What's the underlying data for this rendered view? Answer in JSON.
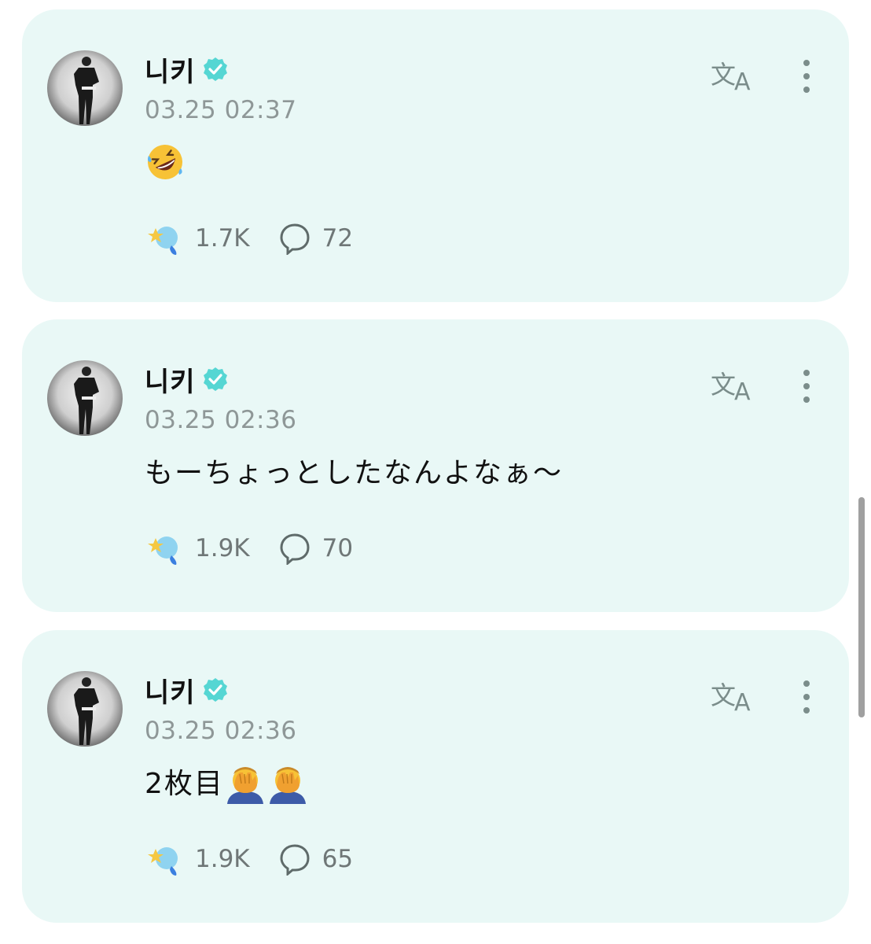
{
  "posts": [
    {
      "author": "니키",
      "verified": true,
      "timestamp": "03.25 02:37",
      "text": "",
      "emojis": [
        "rolling-on-floor-laughing"
      ],
      "reactions": "1.7K",
      "comments": "72"
    },
    {
      "author": "니키",
      "verified": true,
      "timestamp": "03.25 02:36",
      "text": "もーちょっとしたなんよなぁ〜",
      "emojis": [],
      "reactions": "1.9K",
      "comments": "70"
    },
    {
      "author": "니키",
      "verified": true,
      "timestamp": "03.25 02:36",
      "text": "2枚目",
      "emojis": [
        "face-palm",
        "face-palm"
      ],
      "reactions": "1.9K",
      "comments": "65"
    }
  ],
  "icons": {
    "translate": "translate-icon",
    "more": "more-vertical-icon",
    "reaction": "reaction-icon",
    "comment": "comment-icon",
    "verified": "verified-badge-icon"
  },
  "colors": {
    "card_background": "#e9f8f6",
    "verified": "#55d6d3",
    "meta_text": "#8e9797",
    "icon": "#7b8d8b"
  }
}
